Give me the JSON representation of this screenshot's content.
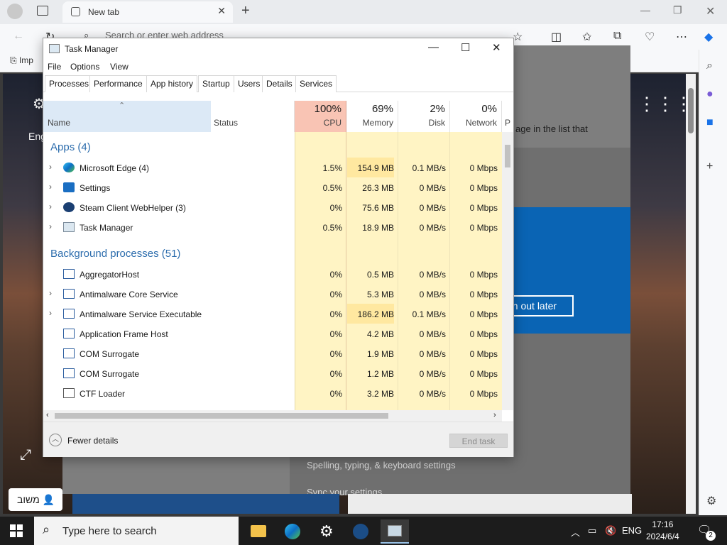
{
  "browser": {
    "tab_title": "New tab",
    "address_placeholder": "Search or enter web address",
    "favorites_item": "Imp"
  },
  "background_page": {
    "text_fragment": "age in the list that",
    "signout_label": "gn out later",
    "spelling_link": "Spelling, typing, & keyboard settings",
    "sync_link": "Sync your settings",
    "left_fragment": "Eng",
    "hebrew_button": "משוב"
  },
  "task_manager": {
    "title": "Task Manager",
    "menu": [
      "File",
      "Options",
      "View"
    ],
    "tabs": [
      "Processes",
      "Performance",
      "App history",
      "Startup",
      "Users",
      "Details",
      "Services"
    ],
    "active_tab": "Processes",
    "columns": {
      "name": "Name",
      "status": "Status",
      "cpu": {
        "pct": "100%",
        "label": "CPU"
      },
      "memory": {
        "pct": "69%",
        "label": "Memory"
      },
      "disk": {
        "pct": "2%",
        "label": "Disk"
      },
      "network": {
        "pct": "0%",
        "label": "Network"
      },
      "power_fragment": "P"
    },
    "sections": {
      "apps": "Apps (4)",
      "background": "Background processes (51)"
    },
    "apps": [
      {
        "name": "Microsoft Edge (4)",
        "cpu": "1.5%",
        "memory": "154.9 MB",
        "disk": "0.1 MB/s",
        "network": "0 Mbps",
        "icon": "edge-icon",
        "expandable": true
      },
      {
        "name": "Settings",
        "cpu": "0.5%",
        "memory": "26.3 MB",
        "disk": "0 MB/s",
        "network": "0 Mbps",
        "icon": "settings-gear-icon",
        "expandable": true
      },
      {
        "name": "Steam Client WebHelper (3)",
        "cpu": "0%",
        "memory": "75.6 MB",
        "disk": "0 MB/s",
        "network": "0 Mbps",
        "icon": "steam-icon",
        "expandable": true
      },
      {
        "name": "Task Manager",
        "cpu": "0.5%",
        "memory": "18.9 MB",
        "disk": "0 MB/s",
        "network": "0 Mbps",
        "icon": "task-manager-icon",
        "expandable": true
      }
    ],
    "background": [
      {
        "name": "AggregatorHost",
        "cpu": "0%",
        "memory": "0.5 MB",
        "disk": "0 MB/s",
        "network": "0 Mbps",
        "icon": "window-icon",
        "expandable": false
      },
      {
        "name": "Antimalware Core Service",
        "cpu": "0%",
        "memory": "5.3 MB",
        "disk": "0 MB/s",
        "network": "0 Mbps",
        "icon": "window-icon",
        "expandable": true
      },
      {
        "name": "Antimalware Service Executable",
        "cpu": "0%",
        "memory": "186.2 MB",
        "disk": "0.1 MB/s",
        "network": "0 Mbps",
        "icon": "window-icon",
        "expandable": true
      },
      {
        "name": "Application Frame Host",
        "cpu": "0%",
        "memory": "4.2 MB",
        "disk": "0 MB/s",
        "network": "0 Mbps",
        "icon": "window-icon",
        "expandable": false
      },
      {
        "name": "COM Surrogate",
        "cpu": "0%",
        "memory": "1.9 MB",
        "disk": "0 MB/s",
        "network": "0 Mbps",
        "icon": "window-icon",
        "expandable": false
      },
      {
        "name": "COM Surrogate",
        "cpu": "0%",
        "memory": "1.2 MB",
        "disk": "0 MB/s",
        "network": "0 Mbps",
        "icon": "window-icon",
        "expandable": false
      },
      {
        "name": "CTF Loader",
        "cpu": "0%",
        "memory": "3.2 MB",
        "disk": "0 MB/s",
        "network": "0 Mbps",
        "icon": "ctf-loader-icon",
        "expandable": false
      }
    ],
    "footer": {
      "fewer_details": "Fewer details",
      "end_task": "End task"
    },
    "colors": {
      "cpu_header": "#f9c4b4",
      "cell_light": "#fff4c4",
      "cell_mid": "#ffe8a0",
      "section": "#2d6dad"
    }
  },
  "taskbar": {
    "search_placeholder": "Type here to search",
    "language": "ENG",
    "time": "17:16",
    "date": "2024/6/4",
    "notification_count": "2"
  }
}
